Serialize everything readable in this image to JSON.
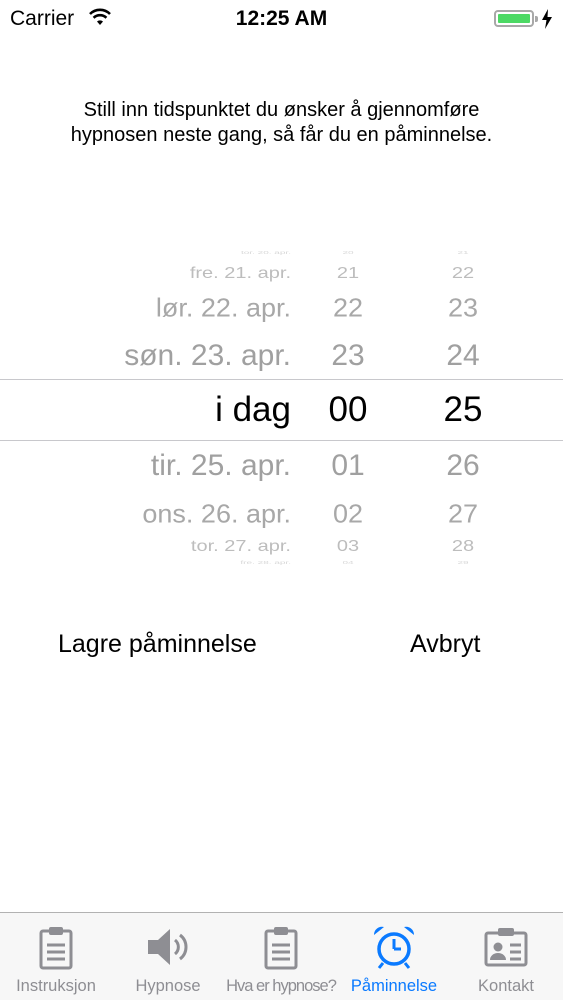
{
  "status_bar": {
    "carrier": "Carrier",
    "time": "12:25 AM"
  },
  "instruction": {
    "line1": "Still inn tidspunktet du ønsker å gjennomføre",
    "line2": "hypnosen neste gang, så får du en påminnelse."
  },
  "picker": {
    "rows": [
      {
        "date": "tor. 20. apr.",
        "hour": "20",
        "minute": "21"
      },
      {
        "date": "fre. 21. apr.",
        "hour": "21",
        "minute": "22"
      },
      {
        "date": "lør. 22. apr.",
        "hour": "22",
        "minute": "23"
      },
      {
        "date": "søn. 23. apr.",
        "hour": "23",
        "minute": "24"
      },
      {
        "date": "i dag",
        "hour": "00",
        "minute": "25"
      },
      {
        "date": "tir. 25. apr.",
        "hour": "01",
        "minute": "26"
      },
      {
        "date": "ons. 26. apr.",
        "hour": "02",
        "minute": "27"
      },
      {
        "date": "tor. 27. apr.",
        "hour": "03",
        "minute": "28"
      },
      {
        "date": "fre. 28. apr.",
        "hour": "04",
        "minute": "29"
      }
    ]
  },
  "actions": {
    "save_label": "Lagre påminnelse",
    "cancel_label": "Avbryt"
  },
  "tabs": [
    {
      "label": "Instruksjon",
      "icon": "clipboard-icon"
    },
    {
      "label": "Hypnose",
      "icon": "speaker-icon"
    },
    {
      "label": "Hva er hypnose?",
      "icon": "clipboard-icon"
    },
    {
      "label": "Påminnelse",
      "icon": "alarm-clock-icon",
      "active": true
    },
    {
      "label": "Kontakt",
      "icon": "contact-card-icon"
    }
  ],
  "colors": {
    "accent": "#0a7aff",
    "inactive_tab": "#8e8e93",
    "battery": "#4cd964",
    "picker_divider": "#c8c8cc"
  }
}
